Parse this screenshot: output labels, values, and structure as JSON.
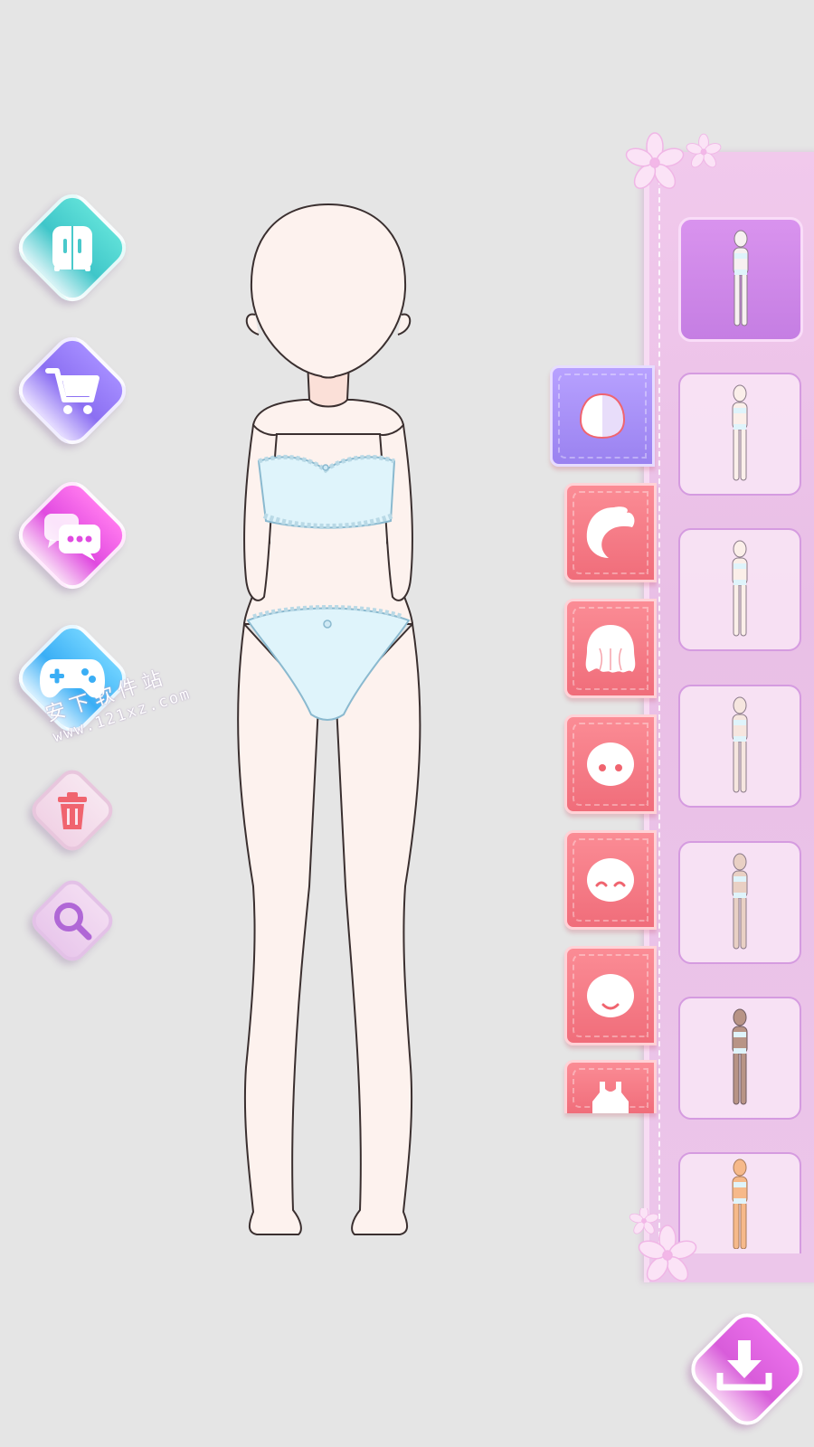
{
  "left_toolbar": {
    "buttons": [
      {
        "name": "closet",
        "icon": "wardrobe-icon"
      },
      {
        "name": "shop",
        "icon": "cart-icon"
      },
      {
        "name": "chat",
        "icon": "chat-bubbles-icon"
      },
      {
        "name": "games",
        "icon": "gamepad-icon"
      },
      {
        "name": "delete",
        "icon": "trash-icon"
      },
      {
        "name": "zoom",
        "icon": "magnifier-icon"
      }
    ]
  },
  "watermark": {
    "text": "安下软件站",
    "url": "www.121xz.com"
  },
  "category_tabs": [
    {
      "name": "skin-tone",
      "icon": "skin-tone-icon",
      "active": true
    },
    {
      "name": "hair-front",
      "icon": "hair-front-icon",
      "active": false
    },
    {
      "name": "hair-back",
      "icon": "hair-back-icon",
      "active": false
    },
    {
      "name": "eyes",
      "icon": "eyes-face-icon",
      "active": false
    },
    {
      "name": "expression",
      "icon": "smile-face-icon",
      "active": false
    },
    {
      "name": "mouth",
      "icon": "mouth-face-icon",
      "active": false
    },
    {
      "name": "top",
      "icon": "top-clothing-icon",
      "active": false
    }
  ],
  "body_presets": [
    {
      "skin": "#f7f1f1",
      "selected": true
    },
    {
      "skin": "#fbefea",
      "selected": false
    },
    {
      "skin": "#fbefe9",
      "selected": false
    },
    {
      "skin": "#f6e6df",
      "selected": false
    },
    {
      "skin": "#e9d0c4",
      "selected": false
    },
    {
      "skin": "#b89486",
      "selected": false
    },
    {
      "skin": "#f6b98a",
      "selected": false
    }
  ],
  "colors": {
    "background": "#e5e5e5",
    "panel": "#ecc6ea",
    "tab_active": "#a48cf5",
    "tab_inactive": "#f37a86",
    "download": "#dd60dd"
  }
}
